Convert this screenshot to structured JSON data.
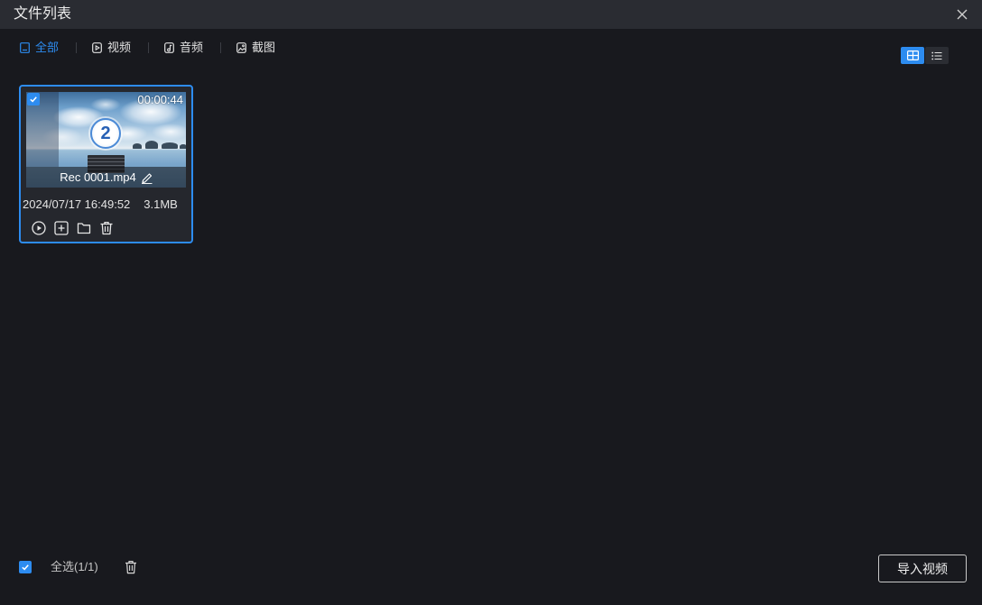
{
  "window": {
    "title": "文件列表",
    "close_icon": "close-icon"
  },
  "tabs": [
    {
      "label": "全部",
      "icon": "file-icon",
      "active": true
    },
    {
      "label": "视频",
      "icon": "video-icon",
      "active": false
    },
    {
      "label": "音频",
      "icon": "audio-icon",
      "active": false
    },
    {
      "label": "截图",
      "icon": "image-icon",
      "active": false
    }
  ],
  "view_toggle": [
    {
      "icon": "grid-icon",
      "active": true
    },
    {
      "icon": "list-icon",
      "active": false
    }
  ],
  "files": [
    {
      "name": "Rec 0001.mp4",
      "duration": "00:00:44",
      "date": "2024/07/17 16:49:52",
      "size": "3.1MB",
      "selected": true,
      "thumbnail_badge": "2",
      "rename_icon": "pencil-icon",
      "actions": [
        "play-circle-icon",
        "plus-square-icon",
        "folder-icon",
        "trash-icon"
      ]
    }
  ],
  "footer": {
    "select_all_label": "全选(1/1)",
    "select_all_checked": true,
    "delete_icon": "trash-icon",
    "import_button_label": "导入视频"
  },
  "colors": {
    "accent": "#2d8cf0",
    "background": "#18191e",
    "title_bar": "#2a2c32",
    "card": "#25272d",
    "text": "#e6e6e6"
  }
}
